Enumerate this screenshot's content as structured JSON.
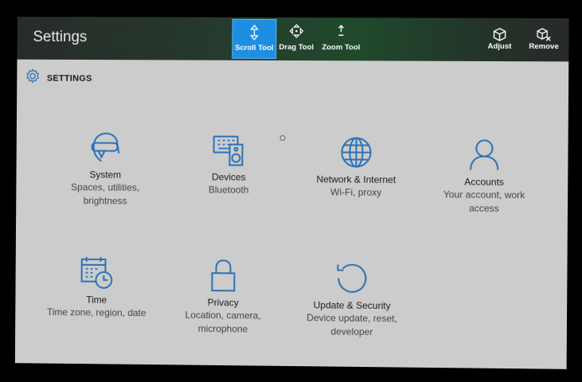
{
  "window": {
    "title": "Settings"
  },
  "toolbar": {
    "tools": [
      {
        "label": "Scroll Tool",
        "active": true,
        "icon": "scroll-icon"
      },
      {
        "label": "Drag Tool",
        "active": false,
        "icon": "drag-icon"
      },
      {
        "label": "Zoom Tool",
        "active": false,
        "icon": "zoom-icon"
      }
    ],
    "actions": [
      {
        "label": "Adjust",
        "icon": "adjust-icon"
      },
      {
        "label": "Remove",
        "icon": "remove-icon"
      }
    ]
  },
  "page": {
    "heading": "SETTINGS",
    "heading_icon": "gear-icon"
  },
  "tiles": [
    {
      "name": "System",
      "desc_lines": [
        "Spaces, utilities,",
        "brightness"
      ],
      "icon": "headset-icon"
    },
    {
      "name": "Devices",
      "desc_lines": [
        "Bluetooth"
      ],
      "icon": "keyboard-speaker-icon"
    },
    {
      "name": "Network & Internet",
      "desc_lines": [
        "Wi-Fi, proxy"
      ],
      "icon": "globe-icon"
    },
    {
      "name": "Accounts",
      "desc_lines": [
        "Your account, work",
        "access"
      ],
      "icon": "person-icon"
    },
    {
      "name": "Time",
      "desc_lines": [
        "Time zone, region, date"
      ],
      "icon": "calendar-clock-icon"
    },
    {
      "name": "Privacy",
      "desc_lines": [
        "Location, camera,",
        "microphone"
      ],
      "icon": "lock-icon"
    },
    {
      "name": "Update & Security",
      "desc_lines": [
        "Device update, reset,",
        "developer"
      ],
      "icon": "refresh-icon"
    }
  ],
  "colors": {
    "accent": "#1e8fe0",
    "icon_blue": "#2b71b8",
    "background": "#cbcccb"
  }
}
